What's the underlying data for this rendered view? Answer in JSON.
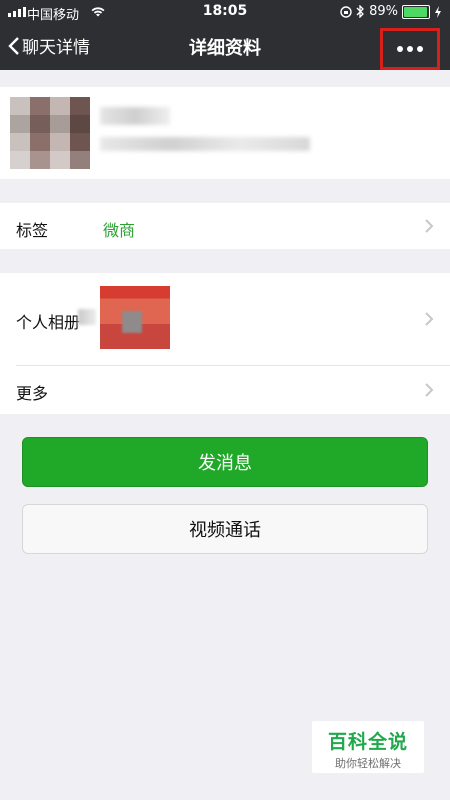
{
  "status_bar": {
    "carrier": "中国移动",
    "time": "18:05",
    "battery_percent": "89%",
    "battery_level": 0.89,
    "icons": [
      "signal-icon",
      "wifi-icon",
      "lock-icon",
      "bluetooth-icon",
      "battery-icon",
      "charging-icon"
    ]
  },
  "nav": {
    "back_label": "聊天详情",
    "title": "详细资料",
    "more_icon": "more-icon"
  },
  "profile": {
    "avatar": "avatar"
  },
  "rows": {
    "tag_label": "标签",
    "tag_value": "微商",
    "album_label": "个人相册",
    "more_label": "更多"
  },
  "buttons": {
    "send_message": "发消息",
    "video_call": "视频通话"
  },
  "watermark": {
    "title": "百科全说",
    "subtitle": "助你轻松解决"
  },
  "colors": {
    "header": "#2e2f33",
    "background": "#efeff4",
    "accent_green": "#20a929",
    "tag_green": "#2aa232",
    "highlight_red": "#d8201b"
  }
}
